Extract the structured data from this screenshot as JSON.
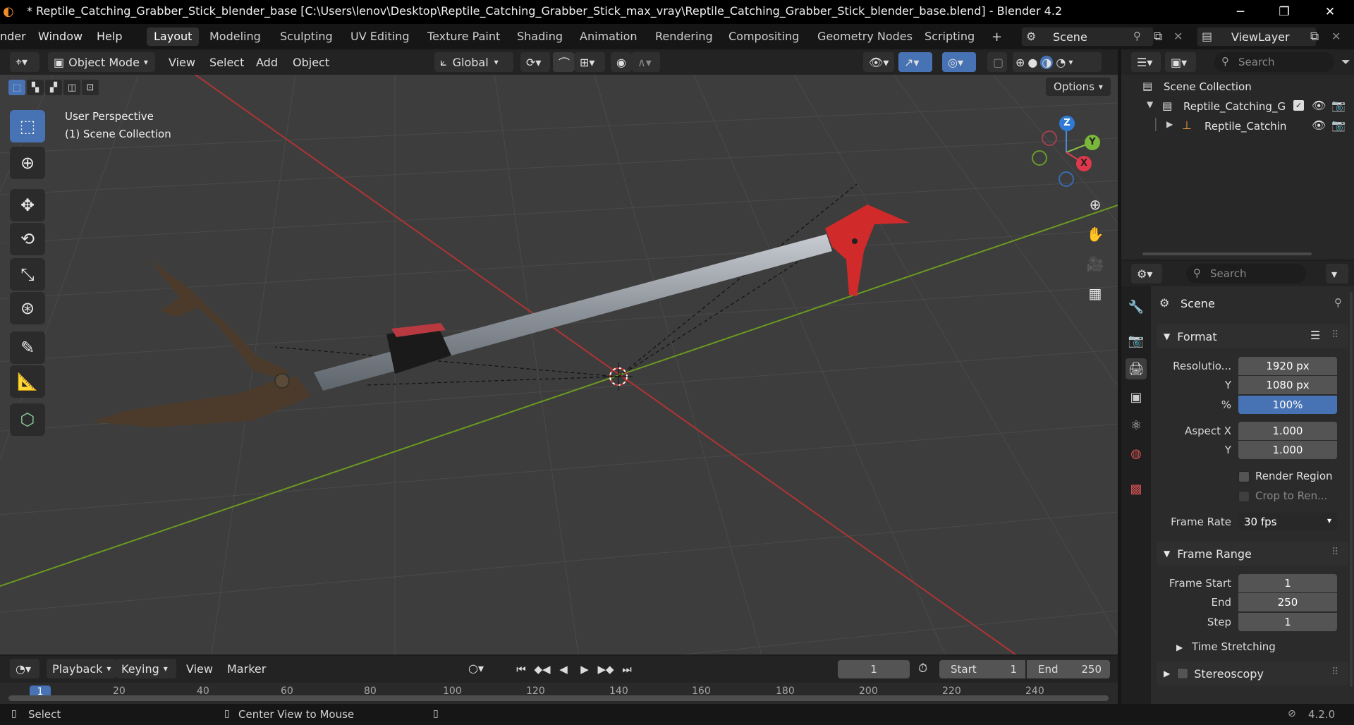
{
  "window": {
    "title": "* Reptile_Catching_Grabber_Stick_blender_base [C:\\Users\\lenov\\Desktop\\Reptile_Catching_Grabber_Stick_max_vray\\Reptile_Catching_Grabber_Stick_blender_base.blend] - Blender 4.2",
    "minimize": "─",
    "maximize": "❐",
    "close": "✕"
  },
  "menu": {
    "render": "nder",
    "window": "Window",
    "help": "Help"
  },
  "workspaces": [
    "Layout",
    "Modeling",
    "Sculpting",
    "UV Editing",
    "Texture Paint",
    "Shading",
    "Animation",
    "Rendering",
    "Compositing",
    "Geometry Nodes",
    "Scripting"
  ],
  "add_workspace": "+",
  "scene": {
    "name": "Scene"
  },
  "view_layer": {
    "name": "ViewLayer"
  },
  "viewport_header": {
    "mode": "Object Mode",
    "view": "View",
    "select": "Select",
    "add": "Add",
    "object": "Object",
    "orientation": "Global",
    "options": "Options"
  },
  "viewport": {
    "perspective": "User Perspective",
    "collection": "(1) Scene Collection",
    "gizmo": {
      "x": "X",
      "y": "Y",
      "z": "Z"
    }
  },
  "outliner": {
    "search_placeholder": "Search",
    "root": "Scene Collection",
    "collection": "Reptile_Catching_G",
    "object": "Reptile_Catchin"
  },
  "properties": {
    "search_placeholder": "Search",
    "context": "Scene",
    "format": {
      "title": "Format",
      "resolution_label": "Resolutio...",
      "res_x": "1920 px",
      "y_label": "Y",
      "res_y": "1080 px",
      "pct_label": "%",
      "pct": "100%",
      "aspect_x_label": "Aspect X",
      "aspect_x": "1.000",
      "aspect_y_label": "Y",
      "aspect_y": "1.000",
      "render_region": "Render Region",
      "crop": "Crop to Ren...",
      "frame_rate_label": "Frame Rate",
      "frame_rate": "30 fps"
    },
    "frame_range": {
      "title": "Frame Range",
      "start_label": "Frame Start",
      "start": "1",
      "end_label": "End",
      "end": "250",
      "step_label": "Step",
      "step": "1"
    },
    "time_stretching": "Time Stretching",
    "stereoscopy": "Stereoscopy"
  },
  "timeline": {
    "playback": "Playback",
    "keying": "Keying",
    "view": "View",
    "marker": "Marker",
    "current_frame": "1",
    "start_label": "Start",
    "start": "1",
    "end_label": "End",
    "end": "250",
    "ruler": [
      "1",
      "20",
      "40",
      "60",
      "80",
      "100",
      "120",
      "140",
      "160",
      "180",
      "200",
      "220",
      "240"
    ]
  },
  "status": {
    "select": "Select",
    "center_view": "Center View to Mouse",
    "version": "4.2.0"
  }
}
